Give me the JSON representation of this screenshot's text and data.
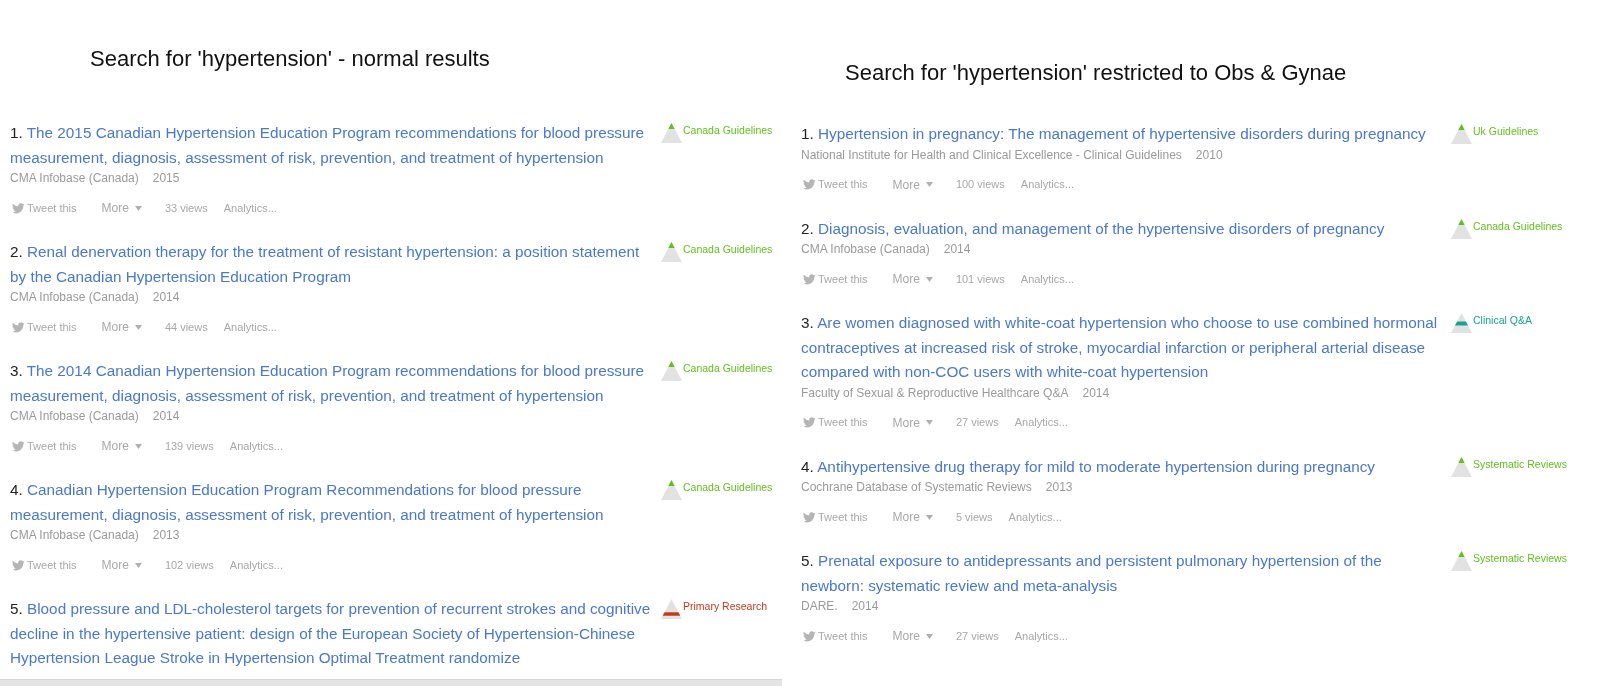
{
  "panels": [
    {
      "heading": "Search for 'hypertension' - normal results",
      "results": [
        {
          "number": "1.",
          "title": "The 2015 Canadian Hypertension Education Program recommendations for blood pressure measurement, diagnosis, assessment of risk, prevention, and treatment of hypertension",
          "source": "CMA Infobase (Canada)",
          "year": "2015",
          "actions": {
            "tweet": "Tweet this",
            "more": "More",
            "views": "33 views",
            "analytics": "Analytics..."
          },
          "evidence": {
            "label": "Canada Guidelines",
            "color": "#62c01e",
            "kind": "top"
          }
        },
        {
          "number": "2.",
          "title": "Renal denervation therapy for the treatment of resistant hypertension: a position statement by the Canadian Hypertension Education Program",
          "source": "CMA Infobase (Canada)",
          "year": "2014",
          "actions": {
            "tweet": "Tweet this",
            "more": "More",
            "views": "44 views",
            "analytics": "Analytics..."
          },
          "evidence": {
            "label": "Canada Guidelines",
            "color": "#62c01e",
            "kind": "top"
          }
        },
        {
          "number": "3.",
          "title": "The 2014 Canadian Hypertension Education Program recommendations for blood pressure measurement, diagnosis, assessment of risk, prevention, and treatment of hypertension",
          "source": "CMA Infobase (Canada)",
          "year": "2014",
          "actions": {
            "tweet": "Tweet this",
            "more": "More",
            "views": "139 views",
            "analytics": "Analytics..."
          },
          "evidence": {
            "label": "Canada Guidelines",
            "color": "#62c01e",
            "kind": "top"
          }
        },
        {
          "number": "4.",
          "title": "Canadian Hypertension Education Program Recommendations for blood pressure measurement, diagnosis, assessment of risk, prevention, and treatment of hypertension",
          "source": "CMA Infobase (Canada)",
          "year": "2013",
          "actions": {
            "tweet": "Tweet this",
            "more": "More",
            "views": "102 views",
            "analytics": "Analytics..."
          },
          "evidence": {
            "label": "Canada Guidelines",
            "color": "#62c01e",
            "kind": "top"
          }
        },
        {
          "number": "5.",
          "title": "Blood pressure and LDL-cholesterol targets for prevention of recurrent strokes and cognitive decline in the hypertensive patient: design of the European Society of Hypertension-Chinese Hypertension League Stroke in Hypertension Optimal Treatment randomize",
          "evidence": {
            "label": "Primary Research",
            "color": "#c43a1c",
            "kind": "bottom"
          }
        }
      ]
    },
    {
      "heading": "Search for 'hypertension' restricted to Obs & Gynae",
      "results": [
        {
          "number": "1.",
          "title": "Hypertension in pregnancy: The management of hypertensive disorders during pregnancy",
          "source": "National Institute for Health and Clinical Excellence - Clinical Guidelines",
          "year": "2010",
          "actions": {
            "tweet": "Tweet this",
            "more": "More",
            "views": "100 views",
            "analytics": "Analytics..."
          },
          "evidence": {
            "label": "Uk Guidelines",
            "color": "#62c01e",
            "kind": "top"
          }
        },
        {
          "number": "2.",
          "title": "Diagnosis, evaluation, and management of the hypertensive disorders of pregnancy",
          "source": "CMA Infobase (Canada)",
          "year": "2014",
          "actions": {
            "tweet": "Tweet this",
            "more": "More",
            "views": "101 views",
            "analytics": "Analytics..."
          },
          "evidence": {
            "label": "Canada Guidelines",
            "color": "#62c01e",
            "kind": "top"
          }
        },
        {
          "number": "3.",
          "title": "Are women diagnosed with white-coat hypertension who choose to use combined hormonal contraceptives at increased risk of stroke, myocardial infarction or peripheral arterial disease compared with non-COC users with white-coat hypertension",
          "source": "Faculty of Sexual & Reproductive Healthcare Q&A",
          "year": "2014",
          "actions": {
            "tweet": "Tweet this",
            "more": "More",
            "views": "27 views",
            "analytics": "Analytics..."
          },
          "evidence": {
            "label": "Clinical Q&A",
            "color": "#17a38c",
            "kind": "middle"
          }
        },
        {
          "number": "4.",
          "title": "Antihypertensive drug therapy for mild to moderate hypertension during pregnancy",
          "source": "Cochrane Database of Systematic Reviews",
          "year": "2013",
          "actions": {
            "tweet": "Tweet this",
            "more": "More",
            "views": "5 views",
            "analytics": "Analytics..."
          },
          "evidence": {
            "label": "Systematic Reviews",
            "color": "#62c01e",
            "kind": "top"
          }
        },
        {
          "number": "5.",
          "title": "Prenatal exposure to antidepressants and persistent pulmonary hypertension of the newborn: systematic review and meta-analysis",
          "source": "DARE.",
          "year": "2014",
          "actions": {
            "tweet": "Tweet this",
            "more": "More",
            "views": "27 views",
            "analytics": "Analytics..."
          },
          "evidence": {
            "label": "Systematic Reviews",
            "color": "#62c01e",
            "kind": "top"
          }
        }
      ]
    }
  ]
}
